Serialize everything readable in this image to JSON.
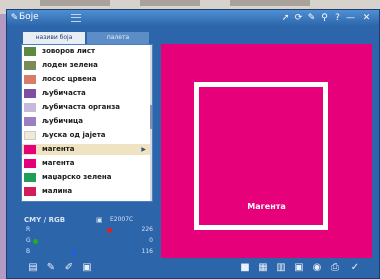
{
  "window": {
    "title": "Боје"
  },
  "tabs": [
    {
      "label": "називи боја"
    },
    {
      "label": "палета"
    }
  ],
  "colors": [
    {
      "name": "зоворов лист",
      "swatch": "#5c8a3e"
    },
    {
      "name": "лоден зелена",
      "swatch": "#7a8c55"
    },
    {
      "name": "лосос црвена",
      "swatch": "#d87b68"
    },
    {
      "name": "љубичаста",
      "swatch": "#7d4fa3"
    },
    {
      "name": "љубичаста органза",
      "swatch": "#c7b9dc"
    },
    {
      "name": "љубичица",
      "swatch": "#9b7fc4"
    },
    {
      "name": "љуска од јајета",
      "swatch": "#f0e9d6"
    },
    {
      "name": "магента",
      "swatch": "#e6007a",
      "selected": true
    },
    {
      "name": "магента",
      "swatch": "#e4007c"
    },
    {
      "name": "маџарско зелена",
      "swatch": "#1f9e57"
    },
    {
      "name": "малина",
      "swatch": "#d11d5a"
    }
  ],
  "color_mode": {
    "options": "CMY / RGB",
    "hex": "E2007C"
  },
  "rgb": [
    {
      "label": "R",
      "value": "226",
      "dot": "#e02020"
    },
    {
      "label": "G",
      "value": "0",
      "dot": "#20b020"
    },
    {
      "label": "B",
      "value": "116",
      "dot": "#2060e0"
    }
  ],
  "preview": {
    "label": "Магента",
    "color": "#e6007a"
  }
}
